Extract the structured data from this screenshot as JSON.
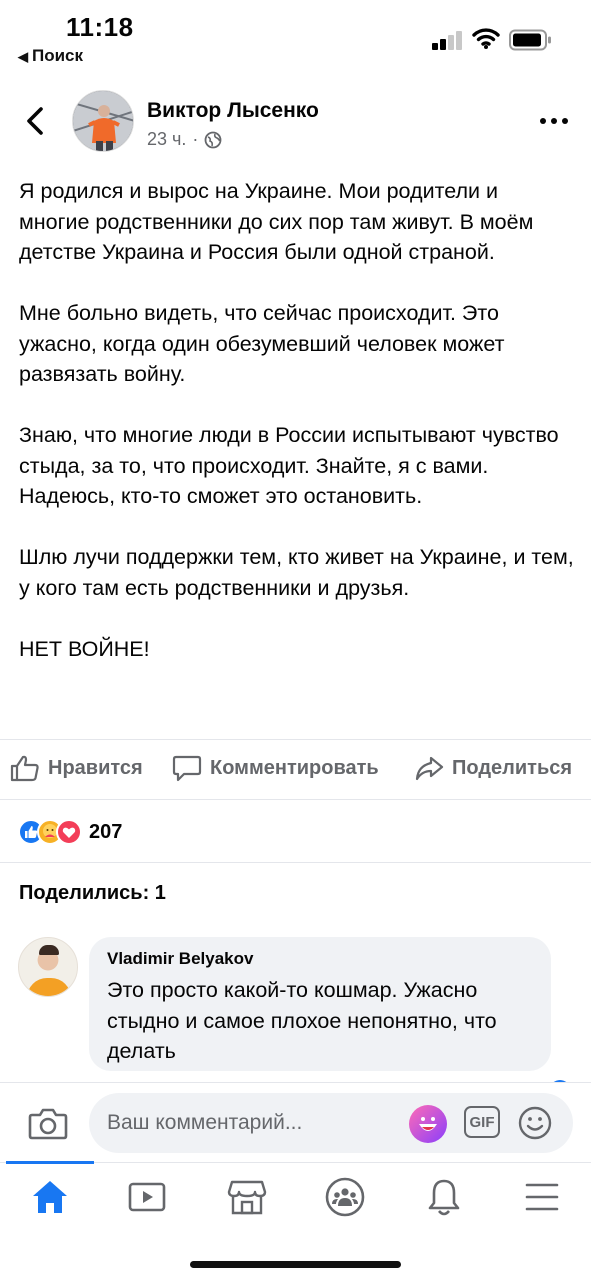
{
  "status_bar": {
    "time": "11:18",
    "back_label": "Поиск"
  },
  "post": {
    "author": "Виктор Лысенко",
    "time_ago": "23 ч.",
    "separator": "·",
    "audience_icon": "globe-icon",
    "paragraphs": [
      "Я родился и вырос на Украине. Мои родители и многие родственники до сих пор там живут. В моём детстве Украина и Россия были одной страной.",
      "Мне больно видеть, что сейчас происходит. Это ужасно, когда один обезумевший человек может развязать войну.",
      "Знаю, что многие люди в России испытывают чувство стыда, за то, что происходит. Знайте, я с вами.\nНадеюсь, кто-то сможет это остановить.",
      "Шлю лучи поддержки тем, кто живет на Украине, и тем, у кого там есть родственники и друзья.",
      "НЕТ ВОЙНЕ!"
    ]
  },
  "actions": {
    "like": "Нравится",
    "comment": "Комментировать",
    "share": "Поделиться"
  },
  "reactions": {
    "types": [
      "like",
      "care",
      "love"
    ],
    "count": "207"
  },
  "shares": {
    "label": "Поделились: 1"
  },
  "comment": {
    "author": "Vladimir Belyakov",
    "text": "Это просто какой-то кошмар. Ужасно стыдно и самое плохое непонятно, что делать"
  },
  "composer": {
    "placeholder": "Ваш комментарий...",
    "gif_label": "GIF"
  },
  "tabbar": {
    "items": [
      "home-icon",
      "video-icon",
      "marketplace-icon",
      "groups-icon",
      "bell-icon",
      "menu-icon"
    ],
    "active": "home-icon"
  },
  "colors": {
    "accent": "#1877f2",
    "secondary_text": "#65676b",
    "bubble_bg": "#f0f2f5",
    "divider": "#e4e6eb"
  }
}
